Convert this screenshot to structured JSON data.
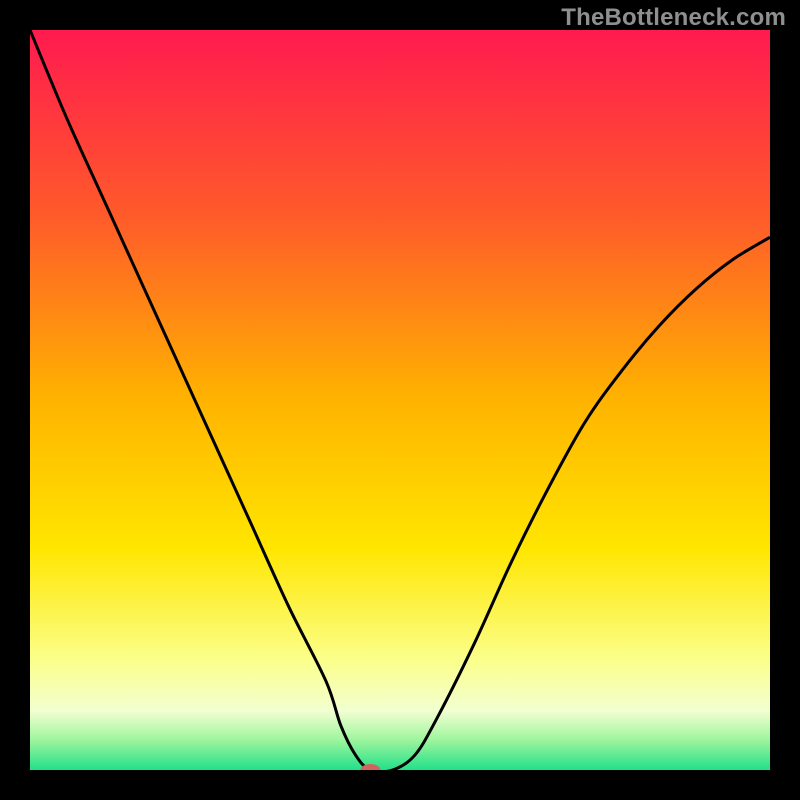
{
  "watermark": "TheBottleneck.com",
  "chart_data": {
    "type": "line",
    "title": "",
    "xlabel": "",
    "ylabel": "",
    "xlim": [
      0,
      100
    ],
    "ylim": [
      0,
      100
    ],
    "grid": false,
    "legend": false,
    "background_gradient": {
      "stops": [
        {
          "pos": 0.0,
          "color": "#ff1a4f"
        },
        {
          "pos": 0.25,
          "color": "#ff5a2a"
        },
        {
          "pos": 0.5,
          "color": "#ffb300"
        },
        {
          "pos": 0.7,
          "color": "#ffe600"
        },
        {
          "pos": 0.85,
          "color": "#fbff89"
        },
        {
          "pos": 0.92,
          "color": "#f2ffd1"
        },
        {
          "pos": 0.96,
          "color": "#9cf59d"
        },
        {
          "pos": 1.0,
          "color": "#22e08a"
        }
      ]
    },
    "series": [
      {
        "name": "bottleneck-curve",
        "x": [
          0,
          5,
          10,
          15,
          20,
          25,
          30,
          35,
          40,
          42,
          44,
          46,
          49,
          52,
          55,
          60,
          65,
          70,
          75,
          80,
          85,
          90,
          95,
          100
        ],
        "y": [
          100,
          88,
          77,
          66,
          55,
          44,
          33,
          22,
          12,
          6,
          2,
          0,
          0,
          2,
          7,
          17,
          28,
          38,
          47,
          54,
          60,
          65,
          69,
          72
        ],
        "color": "#000000",
        "linewidth": 3
      }
    ],
    "marker": {
      "name": "optimal-point",
      "x": 46,
      "y": 0,
      "rx": 10,
      "ry": 6,
      "color": "#d1645b"
    }
  }
}
